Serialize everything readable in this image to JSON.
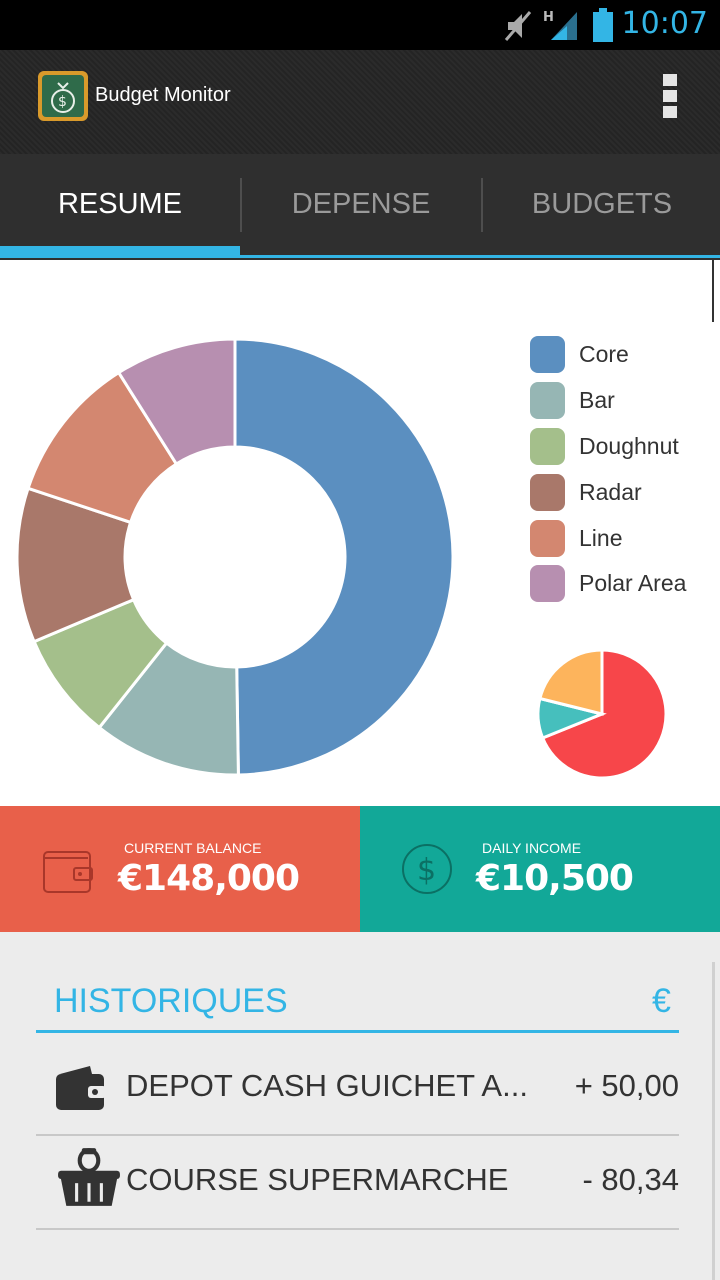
{
  "status_bar": {
    "time": "10:07",
    "icons": [
      "mute-icon",
      "signal-icon",
      "battery-icon"
    ],
    "network_label": "H"
  },
  "app_bar": {
    "title": "Budget Monitor",
    "icon": "money-bag-icon"
  },
  "tabs": [
    {
      "label": "RESUME",
      "active": true
    },
    {
      "label": "DEPENSE",
      "active": false
    },
    {
      "label": "BUDGETS",
      "active": false
    }
  ],
  "chart_data": [
    {
      "type": "pie",
      "variant": "doughnut",
      "categories": [
        "Core",
        "Bar",
        "Doughnut",
        "Radar",
        "Line",
        "Polar Area"
      ],
      "values": [
        50,
        11,
        8,
        11.5,
        11,
        9
      ],
      "colors": [
        "#5b8fc0",
        "#96b6b4",
        "#a4bf8b",
        "#a9786a",
        "#d38770",
        "#b78fb0"
      ],
      "legend": "right"
    },
    {
      "type": "pie",
      "values": [
        62,
        9,
        19
      ],
      "colors": [
        "#f7464a",
        "#46bfbd",
        "#fdb45c"
      ]
    }
  ],
  "legend": [
    {
      "label": "Core",
      "color": "#5b8fc0"
    },
    {
      "label": "Bar",
      "color": "#96b6b4"
    },
    {
      "label": "Doughnut",
      "color": "#a4bf8b"
    },
    {
      "label": "Radar",
      "color": "#a9786a"
    },
    {
      "label": "Line",
      "color": "#d38770"
    },
    {
      "label": "Polar Area",
      "color": "#b78fb0"
    }
  ],
  "stats": {
    "balance": {
      "label": "CURRENT BALANCE",
      "value": "€148,000",
      "icon": "wallet-icon",
      "color": "#e8604a"
    },
    "income": {
      "label": "DAILY INCOME",
      "value": "€10,500",
      "icon": "dollar-circle-icon",
      "color": "#12a898"
    }
  },
  "history": {
    "title": "HISTORIQUES",
    "currency": "€",
    "rows": [
      {
        "label": "DEPOT CASH GUICHET A...",
        "amount": "+ 50,00",
        "icon": "wallet-icon"
      },
      {
        "label": "COURSE SUPERMARCHE",
        "amount": "- 80,34",
        "icon": "shopping-basket-icon"
      }
    ]
  },
  "colors": {
    "accent": "#33b5e5"
  }
}
